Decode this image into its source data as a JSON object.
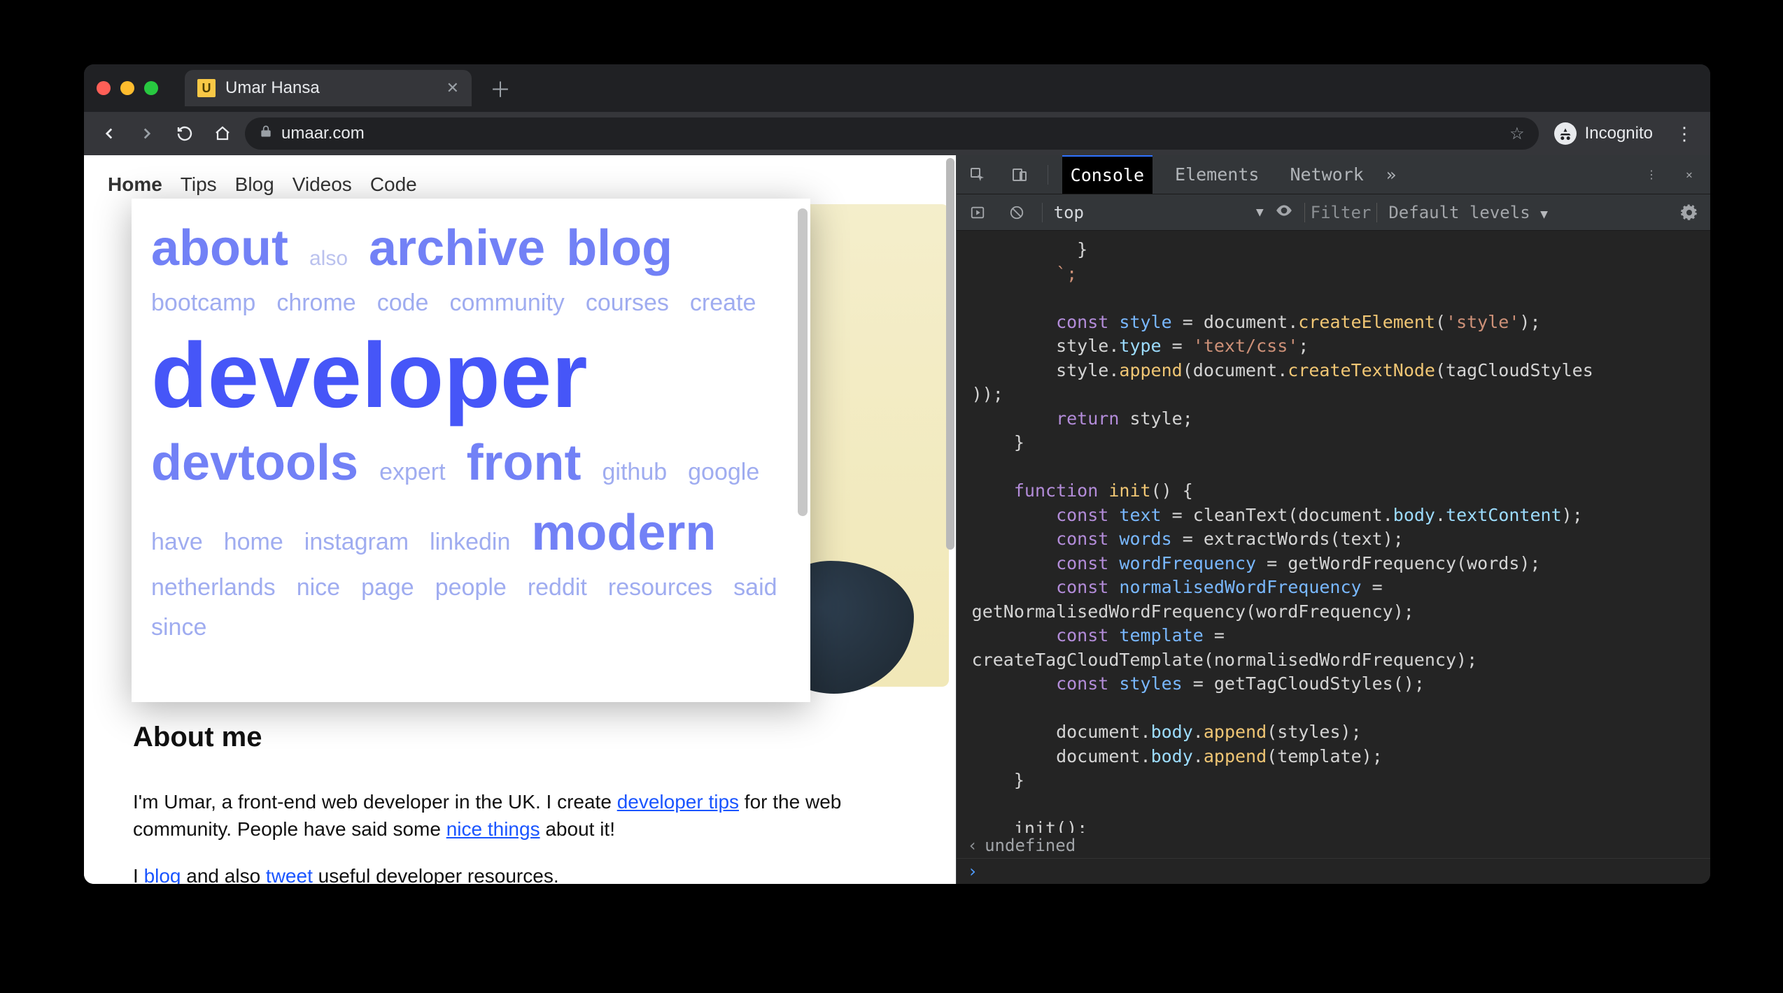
{
  "browser": {
    "tab_title": "Umar Hansa",
    "favicon_letter": "U",
    "url": "umaar.com",
    "incognito_label": "Incognito"
  },
  "site_nav": [
    {
      "name": "home",
      "label": "Home",
      "active": true
    },
    {
      "name": "tips",
      "label": "Tips"
    },
    {
      "name": "blog",
      "label": "Blog"
    },
    {
      "name": "videos",
      "label": "Videos"
    },
    {
      "name": "code",
      "label": "Code"
    }
  ],
  "tagcloud": [
    {
      "word": "about",
      "weight": "w4"
    },
    {
      "word": "also",
      "weight": "w1"
    },
    {
      "word": "archive",
      "weight": "w4"
    },
    {
      "word": "blog",
      "weight": "w4"
    },
    {
      "word": "bootcamp",
      "weight": "w2"
    },
    {
      "word": "chrome",
      "weight": "w2"
    },
    {
      "word": "code",
      "weight": "w2"
    },
    {
      "word": "community",
      "weight": "w2"
    },
    {
      "word": "courses",
      "weight": "w2"
    },
    {
      "word": "create",
      "weight": "w2"
    },
    {
      "word": "developer",
      "weight": "w5"
    },
    {
      "word": "devtools",
      "weight": "w4"
    },
    {
      "word": "expert",
      "weight": "w2"
    },
    {
      "word": "front",
      "weight": "w4"
    },
    {
      "word": "github",
      "weight": "w2"
    },
    {
      "word": "google",
      "weight": "w2"
    },
    {
      "word": "have",
      "weight": "w2"
    },
    {
      "word": "home",
      "weight": "w2"
    },
    {
      "word": "instagram",
      "weight": "w2"
    },
    {
      "word": "linkedin",
      "weight": "w2"
    },
    {
      "word": "modern",
      "weight": "w4"
    },
    {
      "word": "netherlands",
      "weight": "w2"
    },
    {
      "word": "nice",
      "weight": "w2"
    },
    {
      "word": "page",
      "weight": "w2"
    },
    {
      "word": "people",
      "weight": "w2"
    },
    {
      "word": "reddit",
      "weight": "w2"
    },
    {
      "word": "resources",
      "weight": "w2"
    },
    {
      "word": "said",
      "weight": "w2"
    },
    {
      "word": "since",
      "weight": "w2"
    }
  ],
  "about": {
    "heading": "About me",
    "p1_a": "I'm Umar, a front-end web developer in the UK. I create ",
    "p1_link1": "developer tips",
    "p1_b": " for the web community. People have said some ",
    "p1_link2": "nice things",
    "p1_c": " about it!",
    "p2_a": "I ",
    "p2_link1": "blog",
    "p2_b": " and also ",
    "p2_link2": "tweet",
    "p2_c": " useful developer resources."
  },
  "devtools": {
    "tabs": {
      "console": "Console",
      "elements": "Elements",
      "network": "Network"
    },
    "context": "top",
    "filter_placeholder": "Filter",
    "levels_label": "Default levels",
    "result": "undefined",
    "code": {
      "l0": "          }",
      "l1": "        `;",
      "l2": "",
      "l3a": "        ",
      "l3_const": "const ",
      "l3_style": "style",
      "l3_eq": " = ",
      "l3_doc": "document",
      "l3_dot": ".",
      "l3_fn": "createElement",
      "l3_p1": "(",
      "l3_s": "'style'",
      "l3_p2": ");",
      "l4a": "        ",
      "l4_style": "style",
      "l4_dot": ".",
      "l4_prop": "type",
      "l4_eq": " = ",
      "l4_s": "'text/css'",
      "l4_end": ";",
      "l5a": "        ",
      "l5_style": "style",
      "l5_dot": ".",
      "l5_fn": "append",
      "l5_p1": "(",
      "l5_doc": "document",
      "l5_dot2": ".",
      "l5_fn2": "createTextNode",
      "l5_p2": "(",
      "l5_arg": "tagCloudStyles",
      "l5_close1": ")",
      "l5_close2": ")",
      "l5_end": ";",
      "l5wrap": "));",
      "l6a": "        ",
      "l6_return": "return ",
      "l6_style": "style",
      "l6_end": ";",
      "l7": "    }",
      "l8": "",
      "l9a": "    ",
      "l9_fn": "function ",
      "l9_name": "init",
      "l9_sig": "() {",
      "l10a": "        ",
      "l10_const": "const ",
      "l10_var": "text",
      "l10_eq": " = ",
      "l10_fn": "cleanText",
      "l10_p1": "(",
      "l10_doc": "document",
      "l10_dot1": ".",
      "l10_body": "body",
      "l10_dot2": ".",
      "l10_prop": "textContent",
      "l10_p2": ");",
      "l11a": "        ",
      "l11_const": "const ",
      "l11_var": "words",
      "l11_eq": " = ",
      "l11_fn": "extractWords",
      "l11_p1": "(",
      "l11_arg": "text",
      "l11_p2": ");",
      "l12a": "        ",
      "l12_const": "const ",
      "l12_var": "wordFrequency",
      "l12_eq": " = ",
      "l12_fn": "getWordFrequency",
      "l12_p1": "(",
      "l12_arg": "words",
      "l12_p2": ");",
      "l13a": "        ",
      "l13_const": "const ",
      "l13_var": "normalisedWordFrequency",
      "l13_eq": " = ",
      "l13b": "getNormalisedWordFrequency(wordFrequency);",
      "l14a": "        ",
      "l14_const": "const ",
      "l14_var": "template",
      "l14_eq": " = ",
      "l14b": "createTagCloudTemplate(normalisedWordFrequency);",
      "l15a": "        ",
      "l15_const": "const ",
      "l15_var": "styles",
      "l15_eq": " = ",
      "l15_fn": "getTagCloudStyles",
      "l15_p": "();",
      "l16": "",
      "l17a": "        ",
      "l17_doc": "document",
      "l17_dot1": ".",
      "l17_body": "body",
      "l17_dot2": ".",
      "l17_fn": "append",
      "l17_p1": "(",
      "l17_arg": "styles",
      "l17_p2": ");",
      "l18a": "        ",
      "l18_doc": "document",
      "l18_dot1": ".",
      "l18_body": "body",
      "l18_dot2": ".",
      "l18_fn": "append",
      "l18_p1": "(",
      "l18_arg": "template",
      "l18_p2": ");",
      "l19": "    }",
      "l20": "",
      "l21": "    init();"
    }
  }
}
